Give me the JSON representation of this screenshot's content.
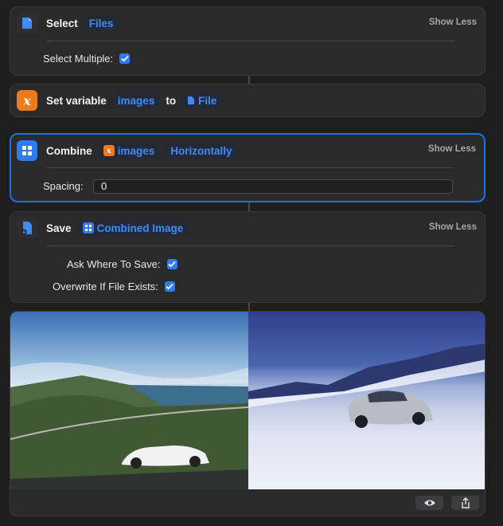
{
  "actions": {
    "select": {
      "verb": "Select",
      "token": "Files",
      "show_less": "Show Less",
      "param_label": "Select Multiple:",
      "param_checked": true
    },
    "set_variable": {
      "verb": "Set variable",
      "variable": "images",
      "connector": "to",
      "value": "File"
    },
    "combine": {
      "verb": "Combine",
      "input": "images",
      "mode": "Horizontally",
      "show_less": "Show Less",
      "spacing_label": "Spacing:",
      "spacing_value": "0"
    },
    "save": {
      "verb": "Save",
      "token": "Combined Image",
      "show_less": "Show Less",
      "params": [
        {
          "label": "Ask Where To Save:",
          "checked": true
        },
        {
          "label": "Overwrite If File Exists:",
          "checked": true
        }
      ]
    }
  },
  "preview": {
    "toolbar": [
      "eye-icon",
      "share-icon"
    ]
  },
  "colors": {
    "accent": "#2f7bf5",
    "variable": "#f07a1a",
    "token_text": "#3d8bff"
  }
}
